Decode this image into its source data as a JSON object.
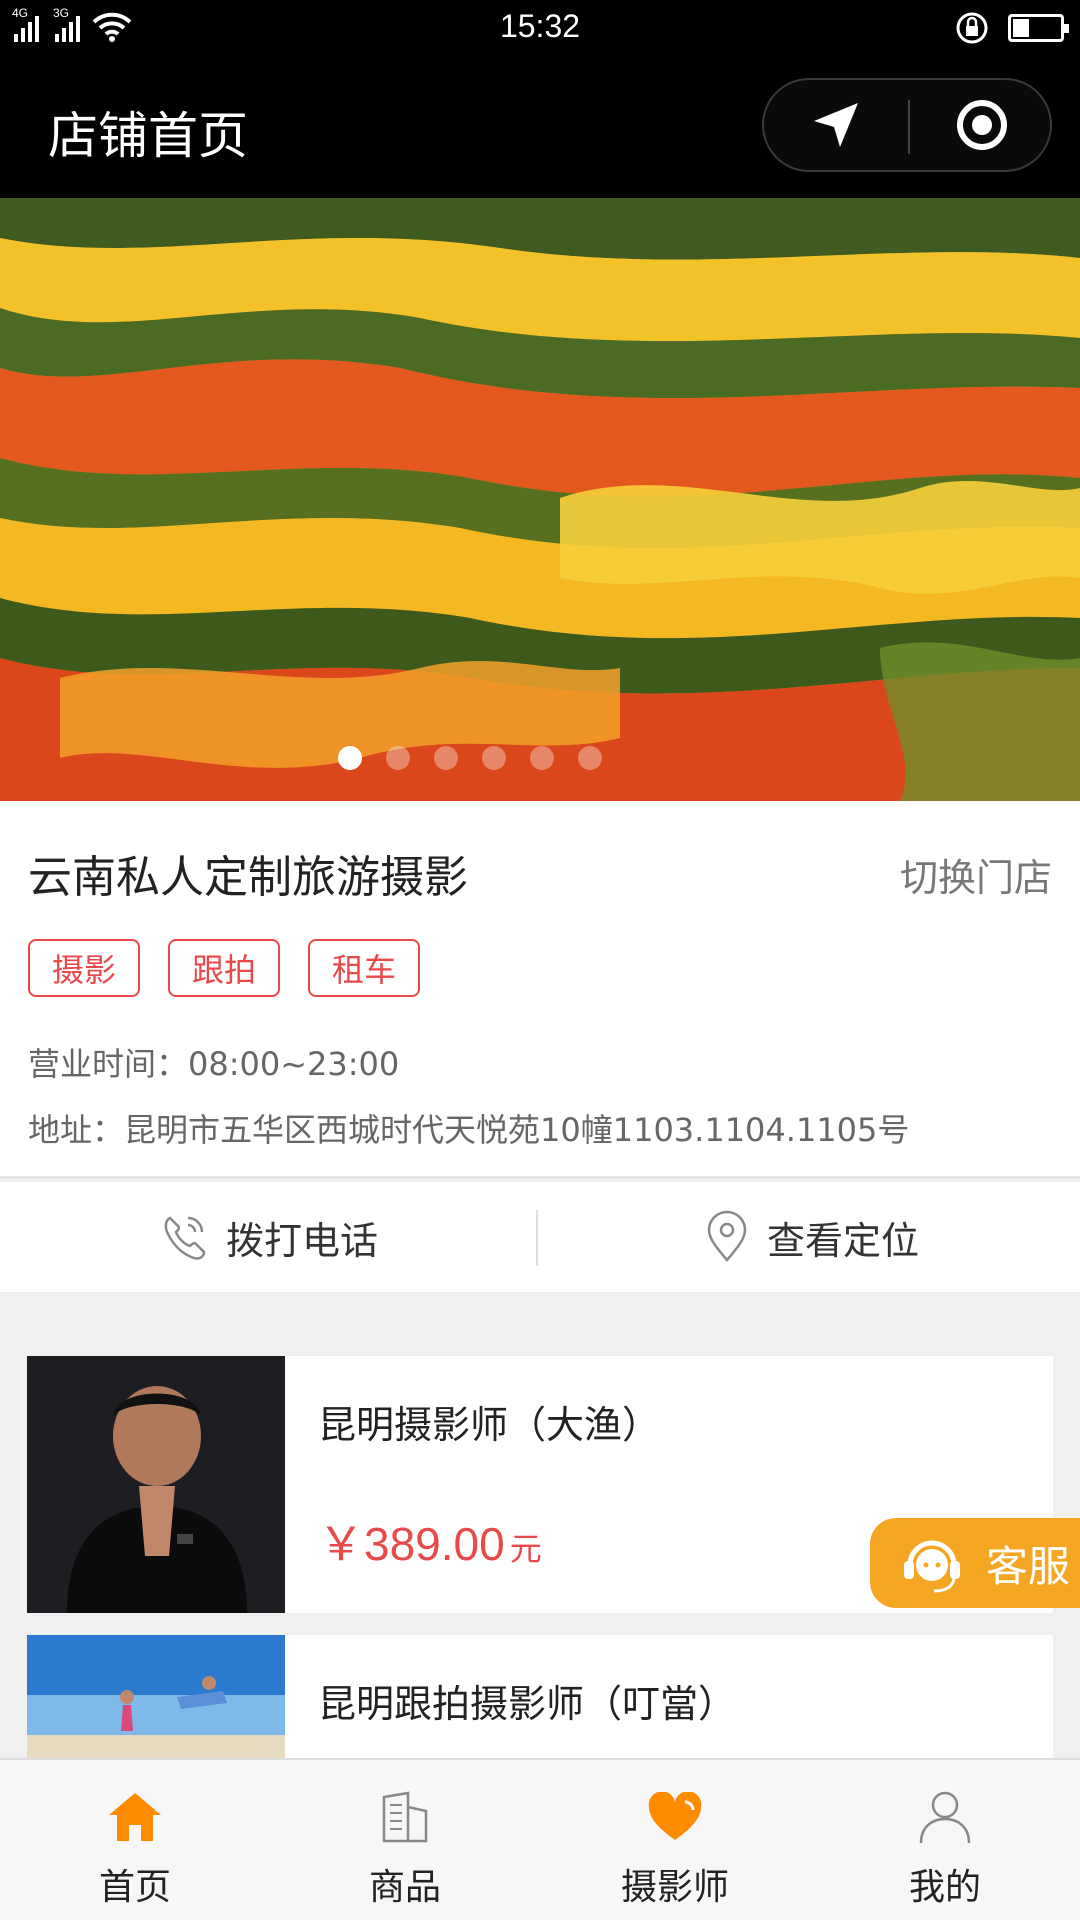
{
  "status_bar": {
    "network_1": "4G",
    "network_2": "3G",
    "time": "15:32",
    "icons": [
      "signal-icon",
      "wifi-icon",
      "rotation-lock-icon",
      "battery-icon"
    ],
    "battery_level": 0.35
  },
  "header": {
    "title": "店铺首页",
    "capsule_icons": [
      "location-arrow-icon",
      "target-icon"
    ]
  },
  "banner": {
    "slide_count": 6,
    "active_slide": 1
  },
  "store": {
    "name": "云南私人定制旅游摄影",
    "switch_label": "切换门店",
    "tags": [
      "摄影",
      "跟拍",
      "租车"
    ],
    "hours": "营业时间：08:00~23:00",
    "address": "地址：昆明市五华区西城时代天悦苑10幢1103.1104.1105号"
  },
  "actions": {
    "call_label": "拨打电话",
    "location_label": "查看定位"
  },
  "products": [
    {
      "title": "昆明摄影师（大渔）",
      "price": "￥389.00",
      "unit": "元"
    },
    {
      "title": "昆明跟拍摄影师（叮當）"
    }
  ],
  "service": {
    "label": "客服"
  },
  "tabbar": {
    "items": [
      {
        "label": "首页",
        "icon": "home-icon",
        "active": true
      },
      {
        "label": "商品",
        "icon": "building-icon",
        "active": false
      },
      {
        "label": "摄影师",
        "icon": "heart-icon",
        "active": true
      },
      {
        "label": "我的",
        "icon": "user-icon",
        "active": false
      }
    ]
  },
  "colors": {
    "accent_orange": "#ff8c00",
    "tag_red": "#e8494b",
    "service_orange": "#f5a623",
    "header_bg": "#000000"
  }
}
